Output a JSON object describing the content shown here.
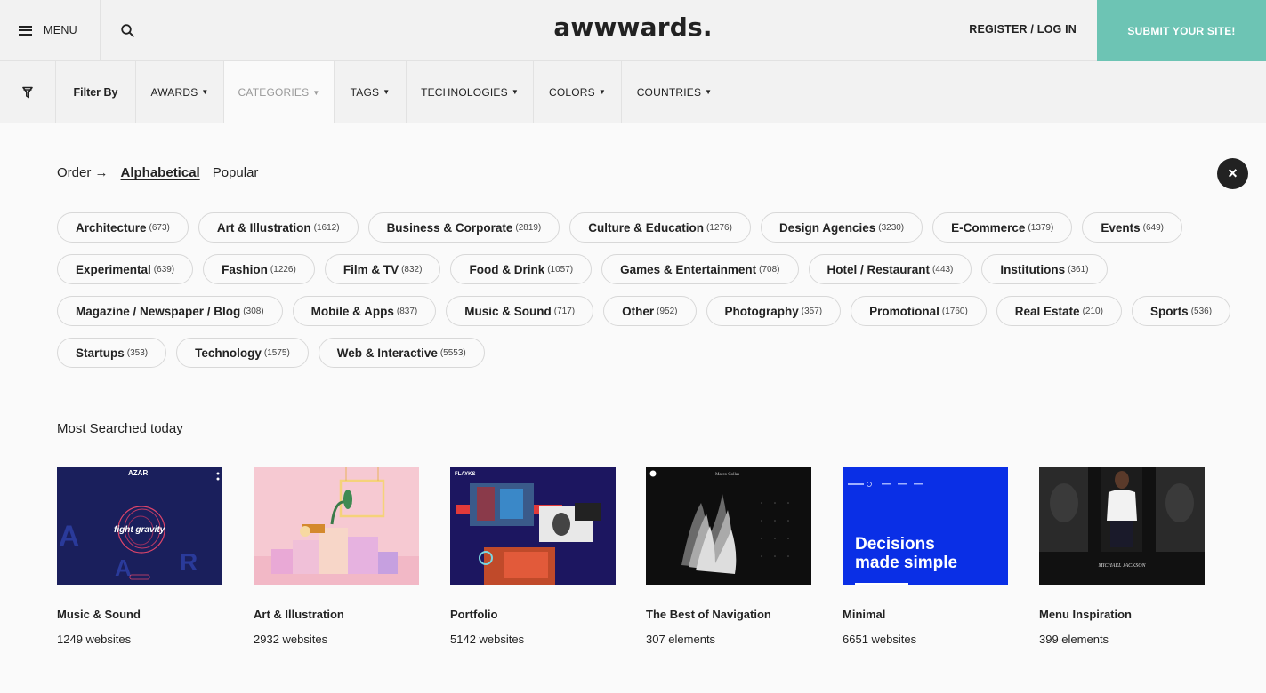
{
  "header": {
    "menu_label": "MENU",
    "logo": "awwwards.",
    "register_label": "REGISTER / LOG IN",
    "submit_label": "SUBMIT YOUR SITE!"
  },
  "filterbar": {
    "filter_by": "Filter By",
    "tabs": [
      {
        "label": "AWARDS"
      },
      {
        "label": "CATEGORIES"
      },
      {
        "label": "TAGS"
      },
      {
        "label": "TECHNOLOGIES"
      },
      {
        "label": "COLORS"
      },
      {
        "label": "COUNTRIES"
      }
    ],
    "caret": "▼"
  },
  "order": {
    "label": "Order →",
    "alphabetical": "Alphabetical",
    "popular": "Popular"
  },
  "close_icon": "×",
  "categories": {
    "rows": [
      [
        {
          "name": "Architecture",
          "count": "(673)"
        },
        {
          "name": "Art & Illustration",
          "count": "(1612)"
        },
        {
          "name": "Business & Corporate",
          "count": "(2819)"
        },
        {
          "name": "Culture & Education",
          "count": "(1276)"
        },
        {
          "name": "Design Agencies",
          "count": "(3230)"
        },
        {
          "name": "E-Commerce",
          "count": "(1379)"
        },
        {
          "name": "Events",
          "count": "(649)"
        }
      ],
      [
        {
          "name": "Experimental",
          "count": "(639)"
        },
        {
          "name": "Fashion",
          "count": "(1226)"
        },
        {
          "name": "Film & TV",
          "count": "(832)"
        },
        {
          "name": "Food & Drink",
          "count": "(1057)"
        },
        {
          "name": "Games & Entertainment",
          "count": "(708)"
        },
        {
          "name": "Hotel / Restaurant",
          "count": "(443)"
        },
        {
          "name": "Institutions",
          "count": "(361)"
        }
      ],
      [
        {
          "name": "Magazine / Newspaper / Blog",
          "count": "(308)"
        },
        {
          "name": "Mobile & Apps",
          "count": "(837)"
        },
        {
          "name": "Music & Sound",
          "count": "(717)"
        },
        {
          "name": "Other",
          "count": "(952)"
        },
        {
          "name": "Photography",
          "count": "(357)"
        },
        {
          "name": "Promotional",
          "count": "(1760)"
        },
        {
          "name": "Real Estate",
          "count": "(210)"
        },
        {
          "name": "Sports",
          "count": "(536)"
        }
      ],
      [
        {
          "name": "Startups",
          "count": "(353)"
        },
        {
          "name": "Technology",
          "count": "(1575)"
        },
        {
          "name": "Web & Interactive",
          "count": "(5553)"
        }
      ]
    ]
  },
  "most_searched": {
    "title": "Most Searched today",
    "items": [
      {
        "title": "Music & Sound",
        "count": "1249 websites",
        "thumb_text": "fight gravity",
        "thumb_brand": "AZAR"
      },
      {
        "title": "Art & Illustration",
        "count": "2932 websites"
      },
      {
        "title": "Portfolio",
        "count": "5142 websites",
        "thumb_brand": "FLAYKS"
      },
      {
        "title": "The Best of Navigation",
        "count": "307 elements",
        "thumb_brand": "Marco Collas"
      },
      {
        "title": "Minimal",
        "count": "6651 websites",
        "thumb_text_1": "Decisions",
        "thumb_text_2": "made simple"
      },
      {
        "title": "Menu Inspiration",
        "count": "399 elements",
        "thumb_text": "MICHAEL JACKSON"
      }
    ]
  },
  "colors": {
    "accent": "#6dc4b4",
    "dark": "#222222",
    "minimal_blue": "#0a2fe6"
  }
}
